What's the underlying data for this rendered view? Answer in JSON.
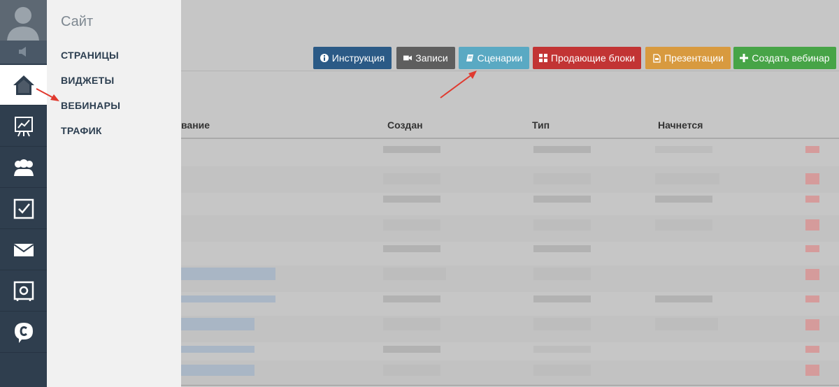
{
  "menu": {
    "title": "Сайт",
    "links": [
      "СТРАНИЦЫ",
      "ВИДЖЕТЫ",
      "ВЕБИНАРЫ",
      "ТРАФИК"
    ]
  },
  "rail": {
    "icons": [
      "avatar-icon",
      "speaker-icon",
      "home-icon",
      "chart-board-icon",
      "users-icon",
      "checkbox-icon",
      "mail-icon",
      "safe-icon",
      "chat-c-icon"
    ],
    "active": "home-icon"
  },
  "toolbar": {
    "buttons": [
      {
        "label": "Инструкция",
        "icon": "info-icon",
        "color": "#2b5a86"
      },
      {
        "label": "Записи",
        "icon": "video-camera-icon",
        "color": "#5e5e5e"
      },
      {
        "label": "Сценарии",
        "icon": "book-icon",
        "color": "#5aa9c3"
      },
      {
        "label": "Продающие блоки",
        "icon": "grid-icon",
        "color": "#c23434"
      },
      {
        "label": "Презентации",
        "icon": "file-icon",
        "color": "#d89a3f"
      },
      {
        "label": "Создать вебинар",
        "icon": "plus-icon",
        "color": "#47a447"
      }
    ]
  },
  "table": {
    "columns": [
      "вание",
      "Создан",
      "Тип",
      "Начнется"
    ]
  },
  "colors": {
    "rail_bg": "#2f3e4e",
    "menu_bg": "#f1f1f1",
    "overlay_bg": "#c6c6c6",
    "annotation_arrow": "#e03a2f"
  }
}
